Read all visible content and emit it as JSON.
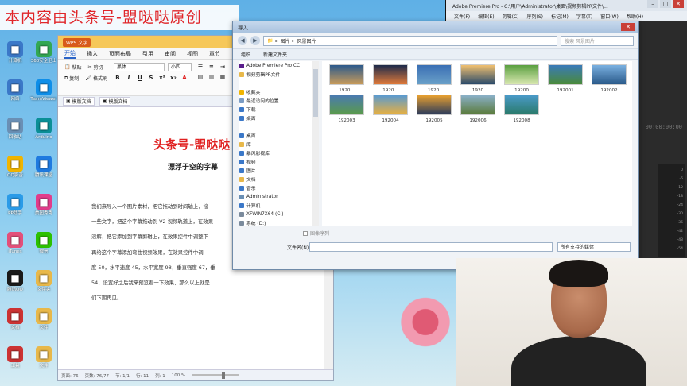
{
  "watermark": "本内容由头条号-盟哒哒原创",
  "desktop_icons": [
    {
      "label": "计算机",
      "icon": "computer-icon",
      "color": "#3b78c8"
    },
    {
      "label": "360安全卫士",
      "icon": "shield-icon",
      "color": "#33a853"
    },
    {
      "label": "网络",
      "icon": "network-icon",
      "color": "#3b78c8"
    },
    {
      "label": "TeamViewer",
      "icon": "teamviewer-icon",
      "color": "#0e8ee9"
    },
    {
      "label": "回收站",
      "icon": "recycle-bin-icon",
      "color": "#6a8fb4"
    },
    {
      "label": "Arduino",
      "icon": "arduino-icon",
      "color": "#0a8f96"
    },
    {
      "label": "QQ影音",
      "icon": "qq-player-icon",
      "color": "#f0b400"
    },
    {
      "label": "腾讯课堂",
      "icon": "classroom-icon",
      "color": "#1f7ae0"
    },
    {
      "label": "PP助手",
      "icon": "pp-icon",
      "color": "#2a9be8"
    },
    {
      "label": "美图秀秀",
      "icon": "meitu-icon",
      "color": "#e23c8b"
    },
    {
      "label": "iTunes",
      "icon": "music-icon",
      "color": "#e3507a"
    },
    {
      "label": "微信",
      "icon": "wechat-icon",
      "color": "#2dc100"
    },
    {
      "label": "腾讯QQ",
      "icon": "qq-icon",
      "color": "#1a1a1a"
    },
    {
      "label": "文件夹",
      "icon": "folder-icon",
      "color": "#e8b84a"
    },
    {
      "label": "文档",
      "icon": "document-icon",
      "color": "#c33"
    },
    {
      "label": "文件",
      "icon": "file-icon",
      "color": "#e8b84a"
    },
    {
      "label": "工具",
      "icon": "tool-icon",
      "color": "#c33"
    },
    {
      "label": "文件",
      "icon": "file-icon",
      "color": "#e8b84a"
    }
  ],
  "wps": {
    "app_name": "WPS 文字",
    "menu": [
      "开始",
      "插入",
      "页面布局",
      "引用",
      "审阅",
      "视图",
      "章节"
    ],
    "paste": "粘贴",
    "cut": "剪切",
    "copy": "复制",
    "format_painter": "格式刷",
    "font_name": "黑体",
    "font_size": "小四",
    "doc_tabs": [
      "模版文档",
      "模版文档"
    ],
    "heading1": "头条号-盟哒哒",
    "heading2": "漂浮于空的字幕",
    "paragraph": [
      "我们来导入一个图片素材，把它拖动到时间轴上，接",
      "一些文字，把这个字幕拖动到 V2 视频轨道上，在效果",
      "溶解，把它添加到字幕剪辑上，在效果控件中调整下",
      "再给这个字幕添加弯曲视频效果，在效果控件中调",
      "度 50，水平速度 45，水平宽度 98，垂直强度 67，垂",
      "54，设置好之后我来预览看一下效果，那么以上就是",
      "们下期再见。"
    ],
    "status": {
      "page": "页面: 76",
      "pages": "页数: 76/77",
      "section": "节: 1/1",
      "row": "行: 11",
      "col": "列: 1",
      "zoom": "100 %"
    }
  },
  "premiere": {
    "title": "Adobe Premiere Pro - C:\\用户\\Administrator\\桌面\\视频剪辑PR文件\\...",
    "menu": [
      "文件(F)",
      "编辑(E)",
      "剪辑(C)",
      "序列(S)",
      "标记(M)",
      "字幕(T)",
      "窗口(W)",
      "帮助(H)"
    ],
    "timecode": "00;00;00;00",
    "meter_scale": [
      "0",
      "-6",
      "-12",
      "-18",
      "-24",
      "-30",
      "-36",
      "-42",
      "-48",
      "-54"
    ]
  },
  "import_dialog": {
    "title": "导入",
    "address": [
      "图片",
      "风景图片"
    ],
    "search_placeholder": "搜索 风景图片",
    "organize": "组织",
    "new_folder": "新建文件夹",
    "nav": [
      {
        "label": "Adobe Premiere Pro CC",
        "icon": "premiere-icon",
        "color": "#5a1e8c"
      },
      {
        "label": "视频剪辑PR文件",
        "icon": "folder-icon",
        "color": "#e8b84a"
      },
      {
        "label": "",
        "icon": "",
        "color": ""
      },
      {
        "label": "收藏夹",
        "icon": "star-icon",
        "color": "#f0b400"
      },
      {
        "label": "最近访问的位置",
        "icon": "recent-icon",
        "color": "#7a9cc4"
      },
      {
        "label": "下载",
        "icon": "download-icon",
        "color": "#3b78c8"
      },
      {
        "label": "桌面",
        "icon": "desktop-icon",
        "color": "#3b78c8"
      },
      {
        "label": "",
        "icon": "",
        "color": ""
      },
      {
        "label": "桌面",
        "icon": "desktop-icon",
        "color": "#3b78c8"
      },
      {
        "label": "库",
        "icon": "library-icon",
        "color": "#e8b84a"
      },
      {
        "label": "暴风影视库",
        "icon": "video-library-icon",
        "color": "#3b78c8"
      },
      {
        "label": "视频",
        "icon": "video-icon",
        "color": "#3b78c8"
      },
      {
        "label": "图片",
        "icon": "picture-icon",
        "color": "#3b78c8"
      },
      {
        "label": "文档",
        "icon": "document-icon",
        "color": "#e8b84a"
      },
      {
        "label": "音乐",
        "icon": "music-icon",
        "color": "#3b78c8"
      },
      {
        "label": "Administrator",
        "icon": "user-icon",
        "color": "#6a8fb4"
      },
      {
        "label": "计算机",
        "icon": "computer-icon",
        "color": "#3b78c8"
      },
      {
        "label": "XFWIN7X64 (C:)",
        "icon": "drive-icon",
        "color": "#7a8a9c"
      },
      {
        "label": "系统 (D:)",
        "icon": "drive-icon",
        "color": "#7a8a9c"
      }
    ],
    "files": [
      {
        "name": "1920...",
        "c1": "#2c5a8c",
        "c2": "#c89b5a"
      },
      {
        "name": "1920...",
        "c1": "#1d2a4a",
        "c2": "#e07a3a"
      },
      {
        "name": "1920.",
        "c1": "#3a6fb4",
        "c2": "#6aa0c8"
      },
      {
        "name": "1920",
        "c1": "#f0c070",
        "c2": "#2a4a6a"
      },
      {
        "name": "19200",
        "c1": "#5aa040",
        "c2": "#d8e8b0"
      },
      {
        "name": "192001",
        "c1": "#3a7ab8",
        "c2": "#4a8a3a"
      },
      {
        "name": "192002",
        "c1": "#7ab0e0",
        "c2": "#2a5a8a"
      },
      {
        "name": "192003",
        "c1": "#4a7ab0",
        "c2": "#5a9a4a"
      },
      {
        "name": "192004",
        "c1": "#5a9ad0",
        "c2": "#e8b040"
      },
      {
        "name": "192005",
        "c1": "#e8a030",
        "c2": "#2a3a5a"
      },
      {
        "name": "192006",
        "c1": "#8ab0c8",
        "c2": "#5a7a3a"
      },
      {
        "name": "192008",
        "c1": "#4a9ac8",
        "c2": "#2a7a6a"
      }
    ],
    "image_sequence": "图像序列",
    "filename_label": "文件名(N):",
    "file_type": "所有支持的媒体"
  }
}
